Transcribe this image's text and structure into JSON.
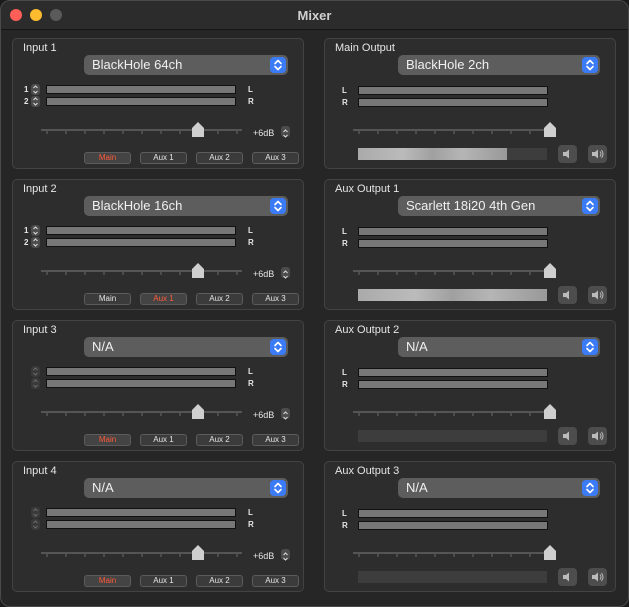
{
  "window": {
    "title": "Mixer"
  },
  "inputs": [
    {
      "title": "Input 1",
      "device": "BlackHole 64ch",
      "ch1": "1",
      "ch2": "2",
      "left": "L",
      "right": "R",
      "gain": "+6dB",
      "fader": 0.78,
      "active_route": "Main",
      "routes": [
        "Main",
        "Aux 1",
        "Aux 2",
        "Aux 3"
      ]
    },
    {
      "title": "Input 2",
      "device": "BlackHole 16ch",
      "ch1": "1",
      "ch2": "2",
      "left": "L",
      "right": "R",
      "gain": "+6dB",
      "fader": 0.78,
      "active_route": "Aux 1",
      "routes": [
        "Main",
        "Aux 1",
        "Aux 2",
        "Aux 3"
      ]
    },
    {
      "title": "Input 3",
      "device": "N/A",
      "ch1": "",
      "ch2": "",
      "left": "L",
      "right": "R",
      "gain": "+6dB",
      "fader": 0.78,
      "active_route": "Main",
      "routes": [
        "Main",
        "Aux 1",
        "Aux 2",
        "Aux 3"
      ]
    },
    {
      "title": "Input 4",
      "device": "N/A",
      "ch1": "",
      "ch2": "",
      "left": "L",
      "right": "R",
      "gain": "+6dB",
      "fader": 0.78,
      "active_route": "Main",
      "routes": [
        "Main",
        "Aux 1",
        "Aux 2",
        "Aux 3"
      ]
    }
  ],
  "outputs": [
    {
      "title": "Main Output",
      "device": "BlackHole 2ch",
      "left": "L",
      "right": "R",
      "fader": 1.0,
      "volume_level": 0.79
    },
    {
      "title": "Aux Output 1",
      "device": "Scarlett 18i20 4th Gen",
      "left": "L",
      "right": "R",
      "fader": 1.0,
      "volume_level": 1.0
    },
    {
      "title": "Aux Output 2",
      "device": "N/A",
      "left": "L",
      "right": "R",
      "fader": 1.0,
      "volume_level": 0.0
    },
    {
      "title": "Aux Output 3",
      "device": "N/A",
      "left": "L",
      "right": "R",
      "fader": 1.0,
      "volume_level": 0.0
    }
  ],
  "colors": {
    "accent": "#3b7bf5",
    "active_route": "#ff5a3a",
    "close": "#ff5f57",
    "minimize": "#febc2e"
  },
  "icons": {
    "select": "chevron-up-down-icon",
    "stepper": "stepper-icon",
    "fader": "fader-thumb-icon",
    "mute": "speaker-mute-icon",
    "volume": "speaker-volume-icon"
  }
}
